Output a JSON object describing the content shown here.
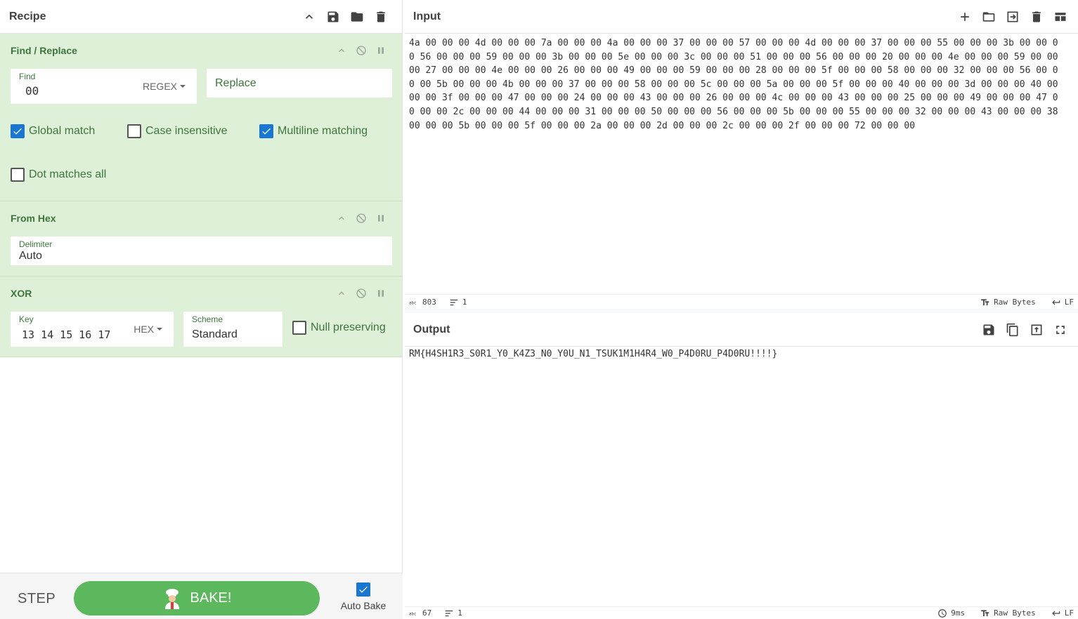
{
  "recipe": {
    "title": "Recipe",
    "operations": [
      {
        "title": "Find / Replace",
        "find_label": "Find",
        "find_value": "00",
        "find_type": "REGEX",
        "replace_placeholder": "Replace",
        "checkboxes": [
          {
            "label": "Global match",
            "checked": true
          },
          {
            "label": "Case insensitive",
            "checked": false
          },
          {
            "label": "Multiline matching",
            "checked": true
          },
          {
            "label": "Dot matches all",
            "checked": false
          }
        ]
      },
      {
        "title": "From Hex",
        "delimiter_label": "Delimiter",
        "delimiter_value": "Auto"
      },
      {
        "title": "XOR",
        "key_label": "Key",
        "key_value": "13 14 15 16 17",
        "key_type": "HEX",
        "scheme_label": "Scheme",
        "scheme_value": "Standard",
        "null_preserving_label": "Null preserving",
        "null_preserving": false
      }
    ]
  },
  "bake": {
    "step_label": "STEP",
    "bake_label": "BAKE!",
    "auto_bake_label": "Auto Bake",
    "auto_bake": true
  },
  "input": {
    "title": "Input",
    "text": "4a 00 00 00 4d 00 00 00 7a 00 00 00 4a 00 00 00 37 00 00 00 57 00 00 00 4d 00 00 00 37 00 00 00 55 00 00 00 3b 00 00 00 56 00 00 00 59 00 00 00 3b 00 00 00 5e 00 00 00 3c 00 00 00 51 00 00 00 56 00 00 00 20 00 00 00 4e 00 00 00 59 00 00 00 27 00 00 00 4e 00 00 00 26 00 00 00 49 00 00 00 59 00 00 00 28 00 00 00 5f 00 00 00 58 00 00 00 32 00 00 00 56 00 00 00 5b 00 00 00 4b 00 00 00 37 00 00 00 58 00 00 00 5c 00 00 00 5a 00 00 00 5f 00 00 00 40 00 00 00 3d 00 00 00 40 00 00 00 3f 00 00 00 47 00 00 00 24 00 00 00 43 00 00 00 26 00 00 00 4c 00 00 00 43 00 00 00 25 00 00 00 49 00 00 00 47 00 00 00 2c 00 00 00 44 00 00 00 31 00 00 00 50 00 00 00 56 00 00 00 5b 00 00 00 55 00 00 00 32 00 00 00 43 00 00 00 38 00 00 00 5b 00 00 00 5f 00 00 00 2a 00 00 00 2d 00 00 00 2c 00 00 00 2f 00 00 00 72 00 00 00",
    "length": "803",
    "lines": "1",
    "encoding": "Raw Bytes",
    "eol": "LF"
  },
  "output": {
    "title": "Output",
    "text": "RM{H4SH1R3_S0R1_Y0_K4Z3_N0_Y0U_N1_TSUK1M1H4R4_W0_P4D0RU_P4D0RU!!!!}",
    "length": "67",
    "lines": "1",
    "time": "9ms",
    "encoding": "Raw Bytes",
    "eol": "LF"
  },
  "colors": {
    "accent": "#1976d2",
    "op_bg": "#dff0d8",
    "op_text": "#3c763d",
    "bake": "#5cb85c"
  }
}
